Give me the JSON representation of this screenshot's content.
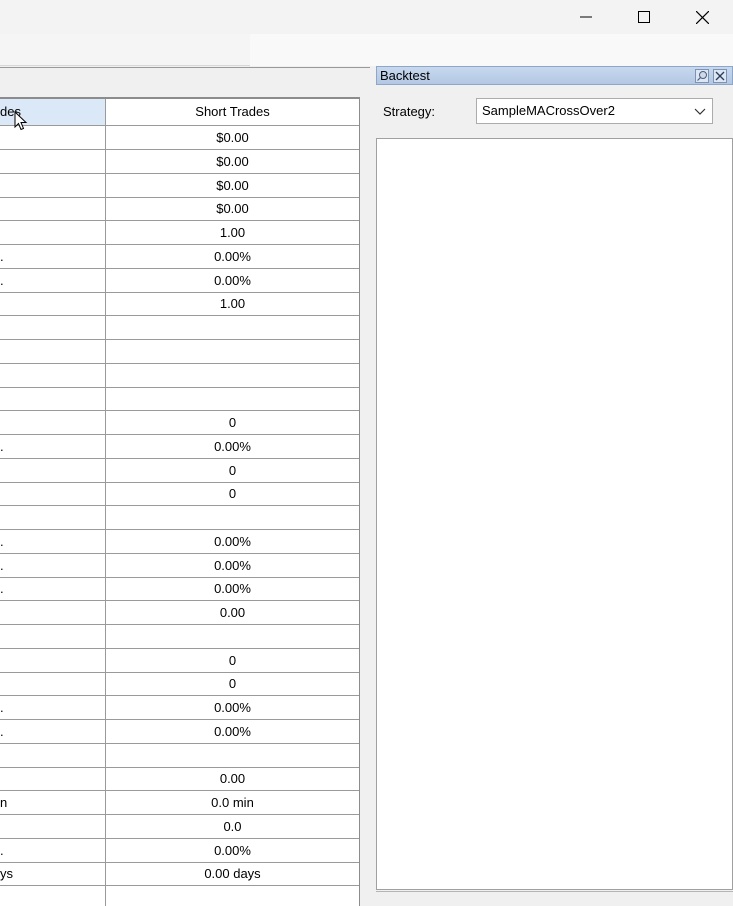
{
  "grid": {
    "header_col1": "des",
    "header_col2": "Short Trades",
    "rows": [
      {
        "c1": "",
        "c2": "$0.00"
      },
      {
        "c1": "",
        "c2": "$0.00"
      },
      {
        "c1": "",
        "c2": "$0.00"
      },
      {
        "c1": "",
        "c2": "$0.00"
      },
      {
        "c1": "",
        "c2": "1.00"
      },
      {
        "c1": ".",
        "c2": "0.00%"
      },
      {
        "c1": ".",
        "c2": "0.00%"
      },
      {
        "c1": "",
        "c2": "1.00"
      },
      {
        "c1": "",
        "c2": ""
      },
      {
        "c1": "",
        "c2": ""
      },
      {
        "c1": "",
        "c2": ""
      },
      {
        "c1": "",
        "c2": ""
      },
      {
        "c1": "",
        "c2": "0"
      },
      {
        "c1": ".",
        "c2": "0.00%"
      },
      {
        "c1": "",
        "c2": "0"
      },
      {
        "c1": "",
        "c2": "0"
      },
      {
        "c1": "",
        "c2": ""
      },
      {
        "c1": ".",
        "c2": "0.00%"
      },
      {
        "c1": ".",
        "c2": "0.00%"
      },
      {
        "c1": ".",
        "c2": "0.00%"
      },
      {
        "c1": "",
        "c2": "0.00"
      },
      {
        "c1": "",
        "c2": ""
      },
      {
        "c1": "",
        "c2": "0"
      },
      {
        "c1": "",
        "c2": "0"
      },
      {
        "c1": ".",
        "c2": "0.00%"
      },
      {
        "c1": ".",
        "c2": "0.00%"
      },
      {
        "c1": "",
        "c2": ""
      },
      {
        "c1": "",
        "c2": "0.00"
      },
      {
        "c1": "n",
        "c2": "0.0 min"
      },
      {
        "c1": "",
        "c2": "0.0"
      },
      {
        "c1": ".",
        "c2": "0.00%"
      },
      {
        "c1": "ys",
        "c2": "0.00 days"
      },
      {
        "c1": "",
        "c2": ""
      }
    ]
  },
  "panel": {
    "title": "Backtest",
    "strategy_label": "Strategy:",
    "strategy_value": "SampleMACrossOver2"
  },
  "icons": {
    "minimize": "minimize-icon",
    "maximize": "maximize-icon",
    "close": "close-icon",
    "pin": "pin-icon",
    "panel_close": "panel-close-icon",
    "dropdown": "chevron-down-icon"
  }
}
